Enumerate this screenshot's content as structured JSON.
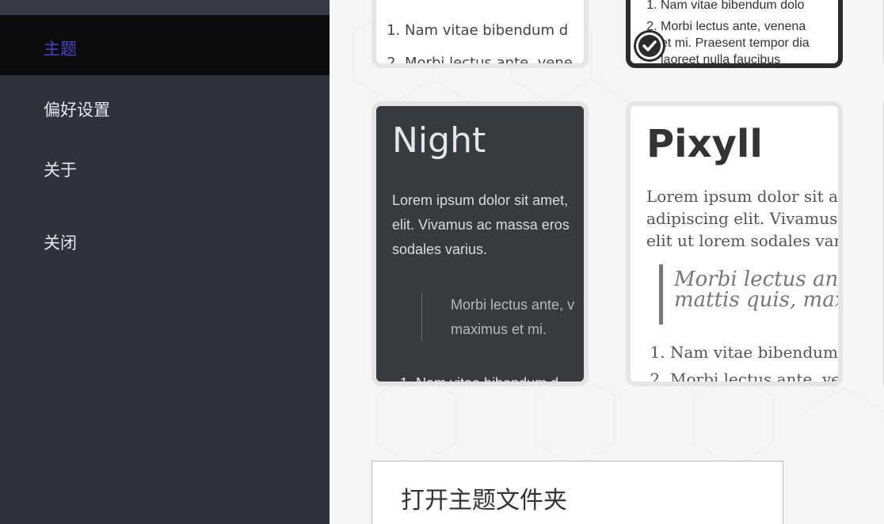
{
  "sidebar": {
    "items": [
      {
        "label": "主题",
        "active": true
      },
      {
        "label": "偏好设置"
      },
      {
        "label": "关于"
      },
      {
        "label": "关闭"
      }
    ]
  },
  "themes": {
    "top_left": {
      "list": [
        "Nam vitae bibendum d",
        "Morbi lectus ante, vene"
      ]
    },
    "top_right": {
      "list_item_1": "Nam vitae bibendum dolo",
      "list_item_2_lines": [
        "Morbi lectus ante, venena",
        "et mi. Praesent tempor dia",
        "laoreet nulla faucibus"
      ],
      "selected": true
    },
    "night": {
      "title": "Night",
      "paragraph": [
        "Lorem ipsum dolor sit amet,",
        "elit. Vivamus ac massa eros",
        "sodales varius."
      ],
      "quote": [
        "Morbi lectus ante, v",
        "maximus et mi."
      ],
      "list_peek": "1. Nam vitae bibendum d"
    },
    "pixyll": {
      "title": "Pixyll",
      "paragraph": [
        "Lorem ipsum dolor sit am",
        "adipiscing elit. Vivamus ac",
        "elit ut lorem sodales variu"
      ],
      "quote": [
        "Morbi lectus ante,",
        "mattis quis, maxi"
      ],
      "list": [
        "Nam vitae bibendum",
        "Morbi lectus ante, ve"
      ]
    }
  },
  "open_folder_label": "打开主题文件夹",
  "colors": {
    "sidebar_bg": "#2d323b",
    "sidebar_active_bg": "#0b0c0e",
    "active_text": "#4a44c4",
    "night_bg": "#363b40",
    "selected_border": "#2b2b2b"
  }
}
